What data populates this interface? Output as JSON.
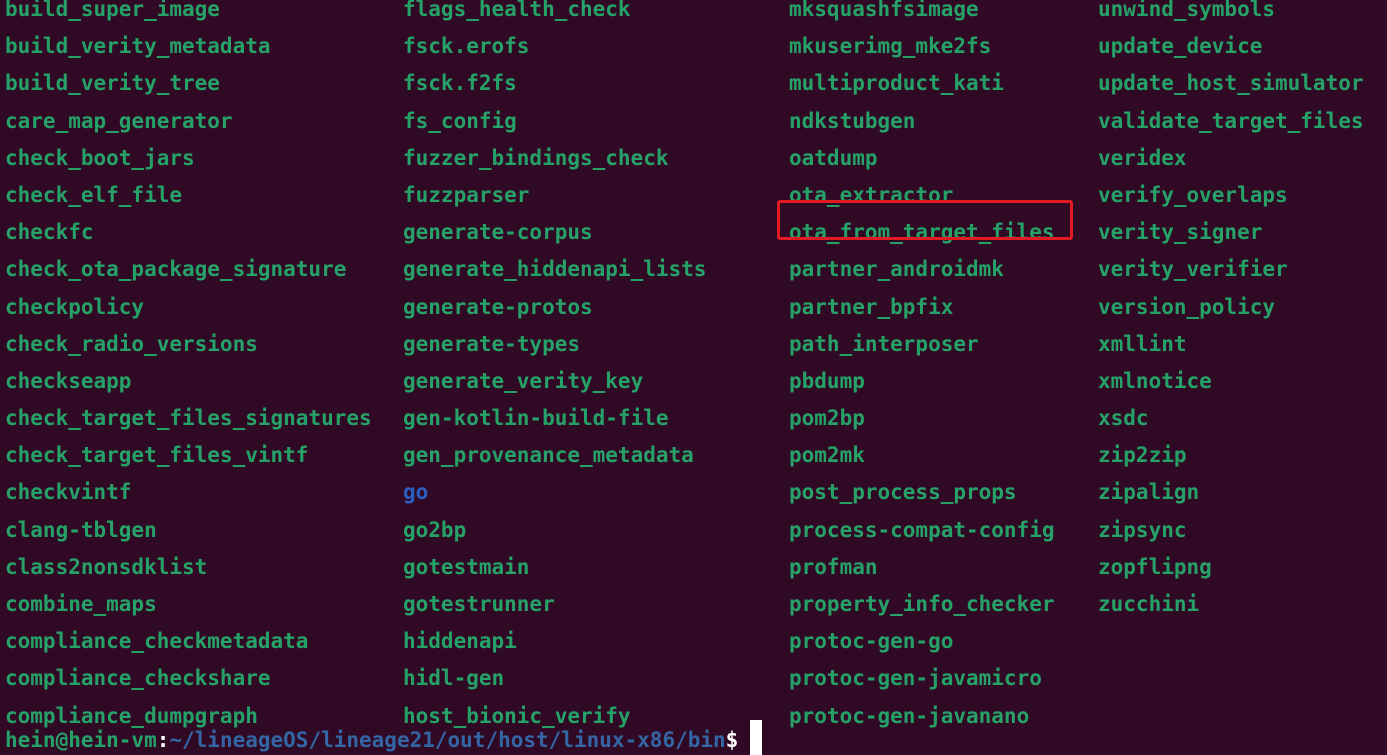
{
  "colors": {
    "background": "#300a24",
    "executable": "#26a269",
    "directory": "#2a5fc4",
    "path": "#3465a4",
    "highlight_box": "#e01b24"
  },
  "rows": [
    [
      "build_super_image",
      "flags_health_check",
      "mksquashfsimage",
      "unwind_symbols"
    ],
    [
      "build_verity_metadata",
      "fsck.erofs",
      "mkuserimg_mke2fs",
      "update_device"
    ],
    [
      "build_verity_tree",
      "fsck.f2fs",
      "multiproduct_kati",
      "update_host_simulator"
    ],
    [
      "care_map_generator",
      "fs_config",
      "ndkstubgen",
      "validate_target_files"
    ],
    [
      "check_boot_jars",
      "fuzzer_bindings_check",
      "oatdump",
      "veridex"
    ],
    [
      "check_elf_file",
      "fuzzparser",
      "ota_extractor",
      "verify_overlaps"
    ],
    [
      "checkfc",
      "generate-corpus",
      "ota_from_target_files",
      "verity_signer"
    ],
    [
      "check_ota_package_signature",
      "generate_hiddenapi_lists",
      "partner_androidmk",
      "verity_verifier"
    ],
    [
      "checkpolicy",
      "generate-protos",
      "partner_bpfix",
      "version_policy"
    ],
    [
      "check_radio_versions",
      "generate-types",
      "path_interposer",
      "xmllint"
    ],
    [
      "checkseapp",
      "generate_verity_key",
      "pbdump",
      "xmlnotice"
    ],
    [
      "check_target_files_signatures",
      "gen-kotlin-build-file",
      "pom2bp",
      "xsdc"
    ],
    [
      "check_target_files_vintf",
      "gen_provenance_metadata",
      "pom2mk",
      "zip2zip"
    ],
    [
      "checkvintf",
      "go",
      "post_process_props",
      "zipalign"
    ],
    [
      "clang-tblgen",
      "go2bp",
      "process-compat-config",
      "zipsync"
    ],
    [
      "class2nonsdklist",
      "gotestmain",
      "profman",
      "zopflipng"
    ],
    [
      "combine_maps",
      "gotestrunner",
      "property_info_checker",
      "zucchini"
    ],
    [
      "compliance_checkmetadata",
      "hiddenapi",
      "protoc-gen-go",
      ""
    ],
    [
      "compliance_checkshare",
      "hidl-gen",
      "protoc-gen-javamicro",
      ""
    ],
    [
      "compliance_dumpgraph",
      "host_bionic_verify",
      "protoc-gen-javanano",
      ""
    ]
  ],
  "directory_entries": [
    "go"
  ],
  "highlighted_entry": "ota_from_target_files",
  "prompt": {
    "user_host": "hein@hein-vm",
    "colon": ":",
    "path": "~/lineageOS/lineage21/out/host/linux-x86/bin",
    "symbol": "$"
  }
}
